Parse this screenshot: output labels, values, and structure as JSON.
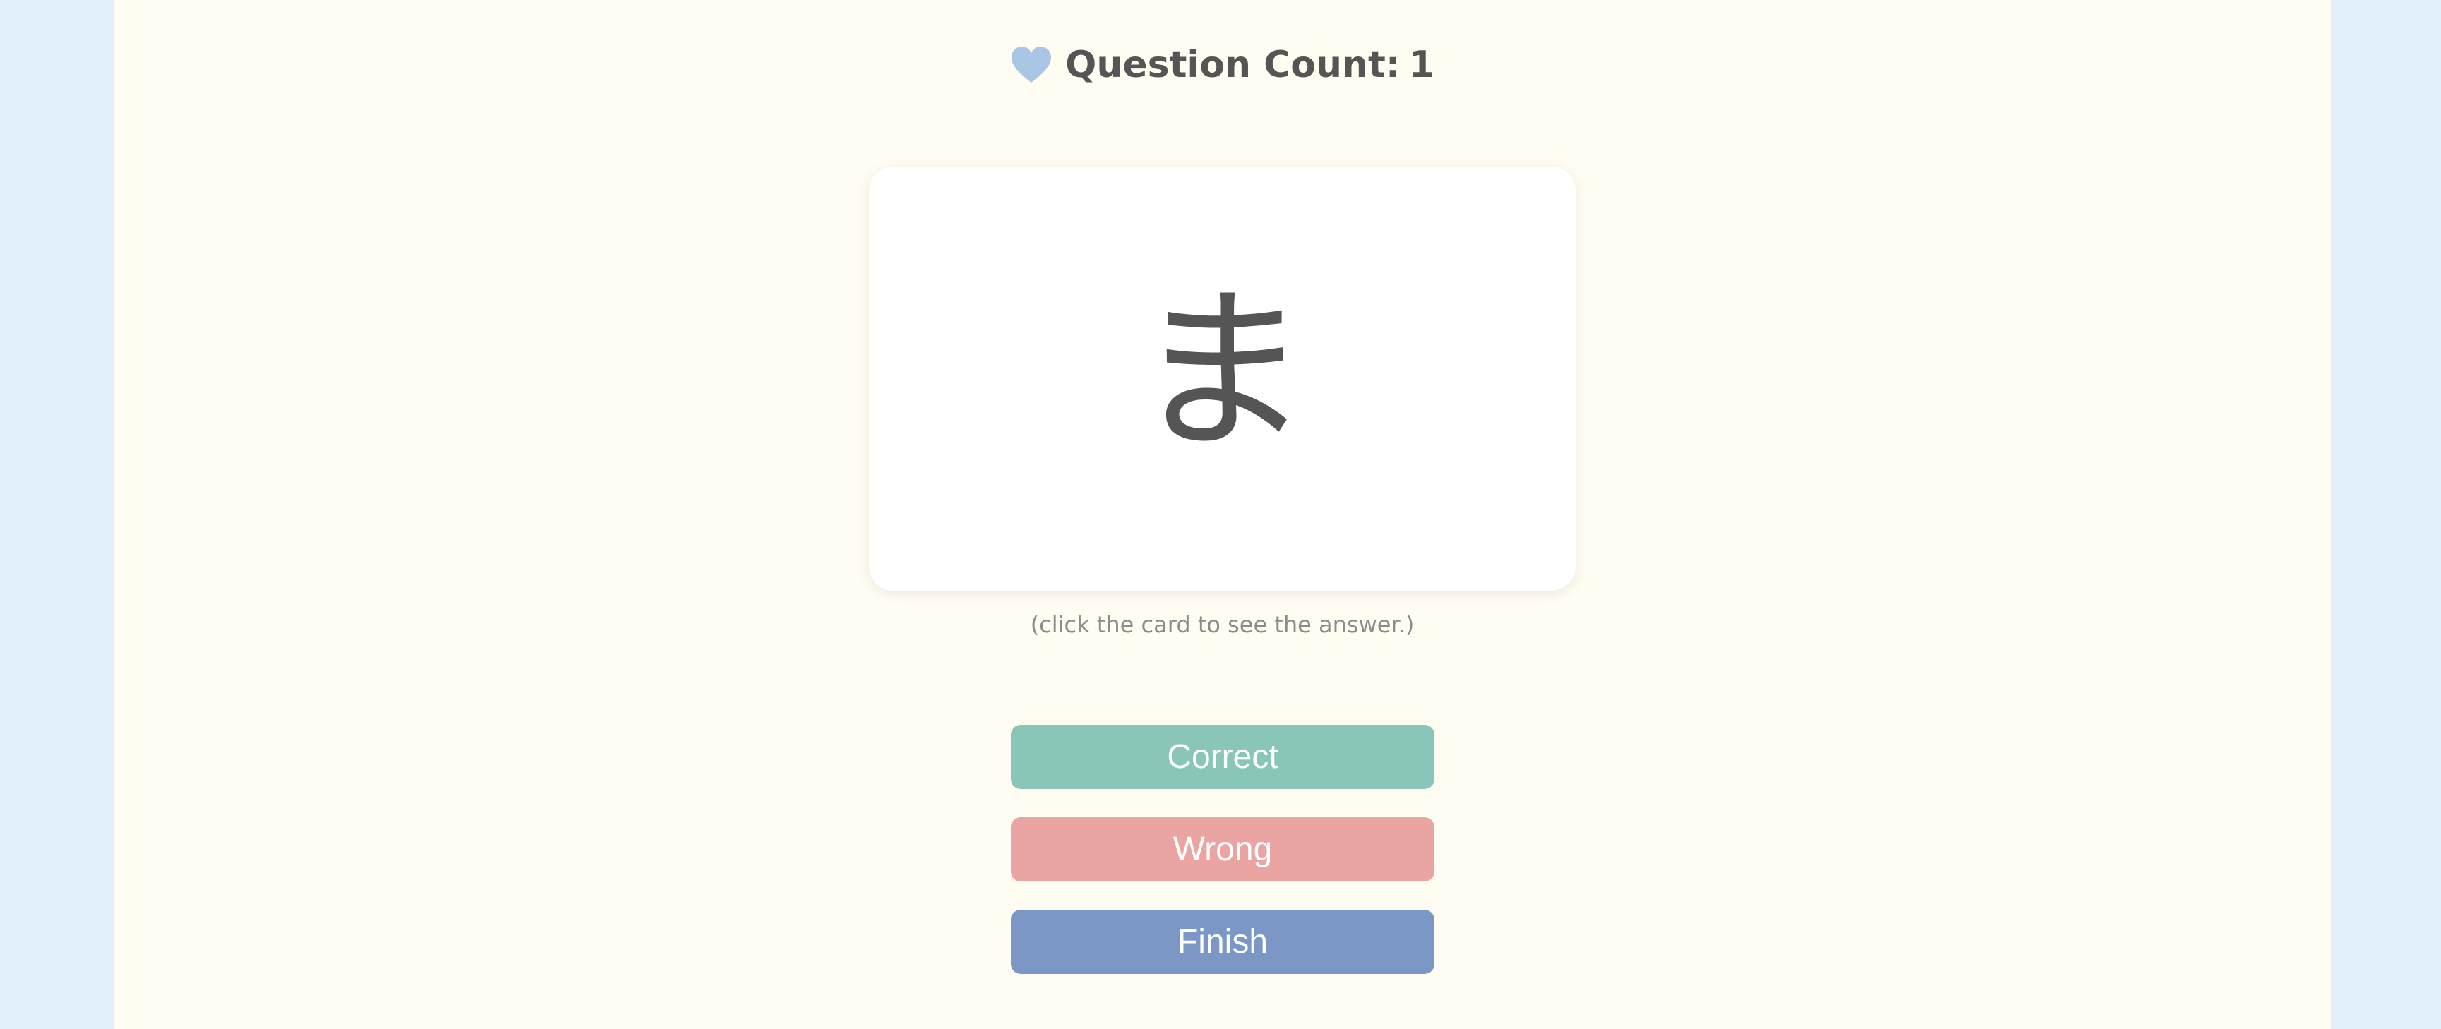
{
  "header": {
    "icon": "heart-icon",
    "label": "Question Count:",
    "count": "1"
  },
  "card": {
    "character": "ま"
  },
  "hint": "(click the card to see the answer.)",
  "buttons": {
    "correct": "Correct",
    "wrong": "Wrong",
    "finish": "Finish"
  },
  "colors": {
    "background": "#e2f0fc",
    "page": "#fffcf2",
    "heart": "#a9c6e4",
    "correct": "#89c6b7",
    "wrong": "#eaa5a2",
    "finish": "#7b97c6"
  }
}
